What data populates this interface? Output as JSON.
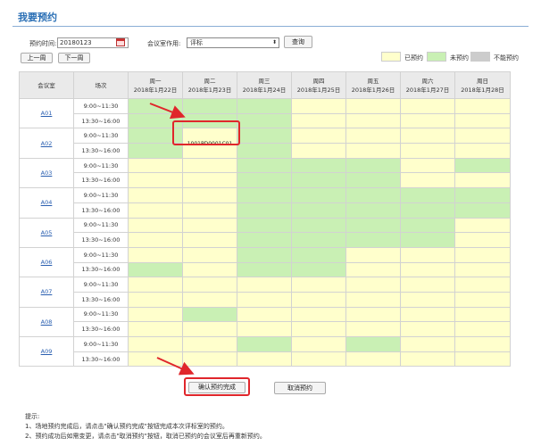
{
  "page": {
    "title": "我要预约"
  },
  "filters": {
    "date_label": "预约时间:",
    "date_value": "20180123",
    "room_use_label": "会议室作用:",
    "room_use_value": "评标",
    "query_label": "查询",
    "prev_week_label": "上一周",
    "next_week_label": "下一周"
  },
  "legend": {
    "booked": "已预约",
    "available": "未预约",
    "unavailable": "不能预约",
    "colors": {
      "booked": "#ffffcc",
      "available": "#c9f0b4",
      "unavailable": "#cccccc"
    }
  },
  "table": {
    "headers": {
      "room": "会议室",
      "session": "场次",
      "days": [
        {
          "weekday": "周一",
          "date": "2018年1月22日"
        },
        {
          "weekday": "周二",
          "date": "2018年1月23日"
        },
        {
          "weekday": "周三",
          "date": "2018年1月24日"
        },
        {
          "weekday": "周四",
          "date": "2018年1月25日"
        },
        {
          "weekday": "周五",
          "date": "2018年1月26日"
        },
        {
          "weekday": "周六",
          "date": "2018年1月27日"
        },
        {
          "weekday": "周日",
          "date": "2018年1月28日"
        }
      ]
    },
    "slots": [
      "9:00~11:30",
      "13:30~16:00"
    ],
    "rooms": [
      {
        "name": "A01",
        "rows": [
          [
            "g",
            "g",
            "g",
            "y",
            "y",
            "y",
            "y"
          ],
          [
            "g",
            "g",
            "g",
            "y",
            "y",
            "y",
            "y"
          ]
        ]
      },
      {
        "name": "A02",
        "rows": [
          [
            "g",
            "sel",
            "g",
            "y",
            "y",
            "y",
            "y"
          ],
          [
            "g",
            "sel",
            "g",
            "y",
            "y",
            "y",
            "y"
          ]
        ]
      },
      {
        "name": "A03",
        "rows": [
          [
            "y",
            "y",
            "g",
            "g",
            "g",
            "y",
            "g"
          ],
          [
            "y",
            "y",
            "g",
            "g",
            "g",
            "y",
            "y"
          ]
        ]
      },
      {
        "name": "A04",
        "rows": [
          [
            "y",
            "y",
            "g",
            "g",
            "g",
            "g",
            "g"
          ],
          [
            "y",
            "y",
            "g",
            "g",
            "g",
            "g",
            "g"
          ]
        ]
      },
      {
        "name": "A05",
        "rows": [
          [
            "y",
            "y",
            "g",
            "g",
            "g",
            "g",
            "y"
          ],
          [
            "y",
            "y",
            "g",
            "g",
            "g",
            "g",
            "y"
          ]
        ]
      },
      {
        "name": "A06",
        "rows": [
          [
            "y",
            "y",
            "g",
            "g",
            "y",
            "y",
            "y"
          ],
          [
            "g",
            "y",
            "g",
            "g",
            "y",
            "y",
            "y"
          ]
        ]
      },
      {
        "name": "A07",
        "rows": [
          [
            "y",
            "y",
            "y",
            "y",
            "y",
            "y",
            "y"
          ],
          [
            "y",
            "y",
            "y",
            "y",
            "y",
            "y",
            "y"
          ]
        ]
      },
      {
        "name": "A08",
        "rows": [
          [
            "y",
            "g",
            "y",
            "y",
            "y",
            "y",
            "y"
          ],
          [
            "y",
            "y",
            "y",
            "y",
            "y",
            "y",
            "y"
          ]
        ]
      },
      {
        "name": "A09",
        "rows": [
          [
            "y",
            "y",
            "g",
            "y",
            "g",
            "y",
            "y"
          ],
          [
            "y",
            "y",
            "y",
            "y",
            "y",
            "y",
            "y"
          ]
        ]
      }
    ],
    "selected_text": "1001PD0001C01"
  },
  "actions": {
    "confirm_label": "确认预约完成",
    "cancel_label": "取消预约"
  },
  "tips": {
    "heading": "提示:",
    "line1": "1、场地预约完成后，请点击\"确认预约完成\"按钮完成本次评标室的预约。",
    "line2": "2、预约成功后如需变更，请点击\"取消预约\"按钮，取消已预约的会议室后再重新预约。"
  }
}
